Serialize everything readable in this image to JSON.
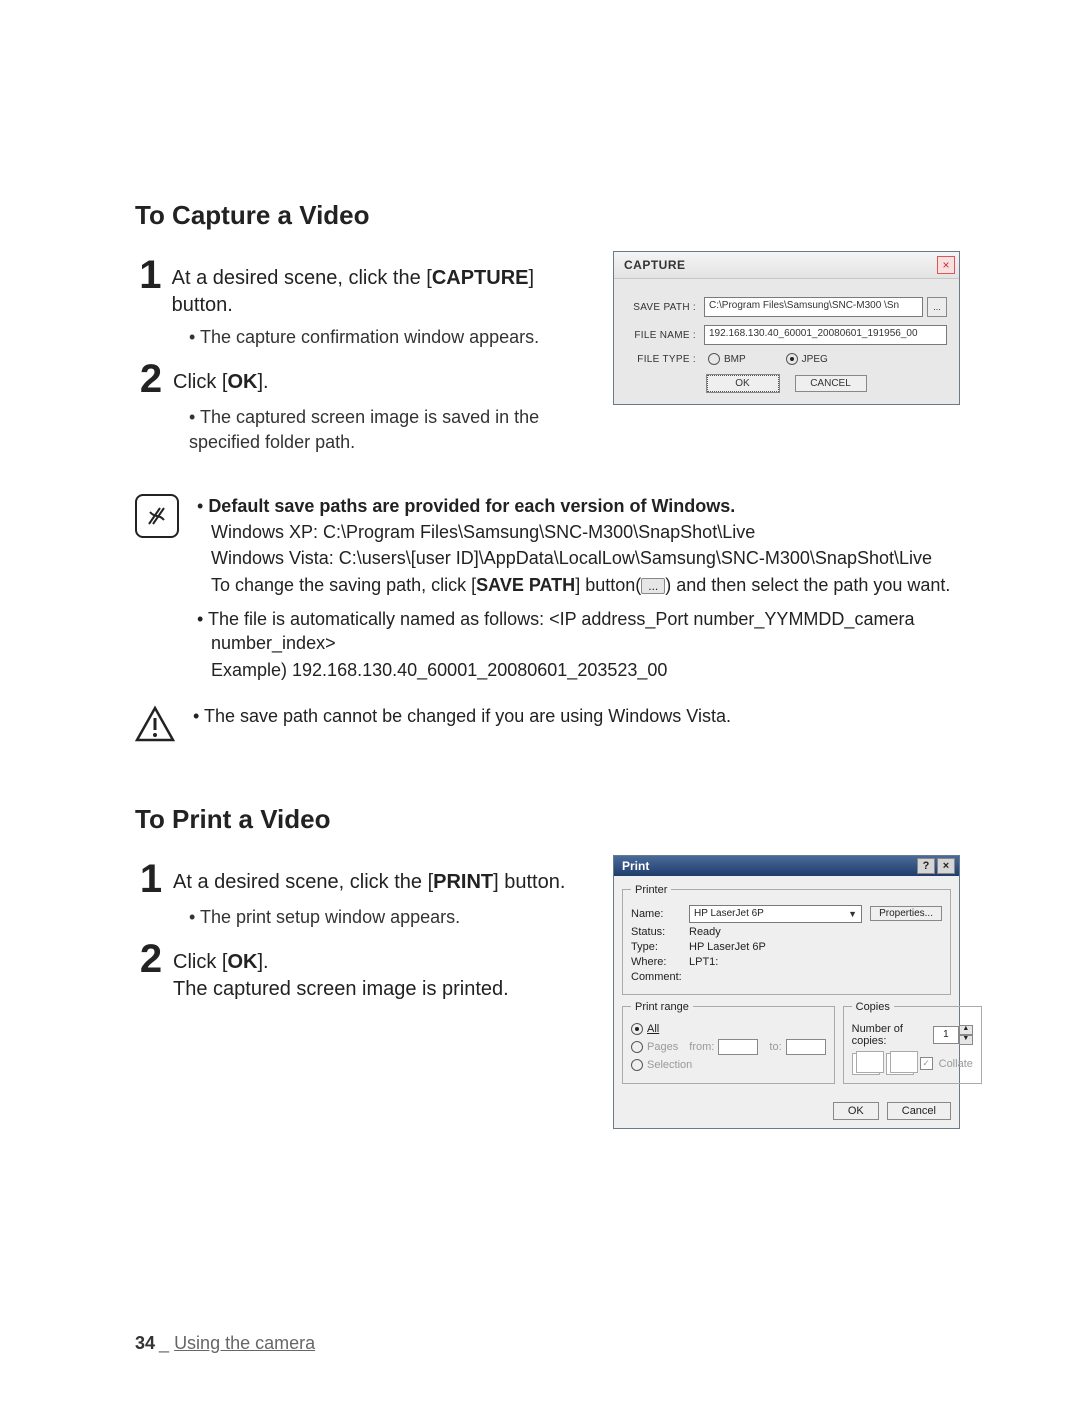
{
  "sections": {
    "capture": {
      "heading": "To Capture a Video",
      "step1_prefix": "At a desired scene, click the [",
      "step1_bold": "CAPTURE",
      "step1_suffix": "] button.",
      "step1_sub": "The capture confirmation window appears.",
      "step2_prefix": "Click [",
      "step2_bold": "OK",
      "step2_suffix": "].",
      "step2_sub": "The captured screen image is saved in the specified folder path."
    },
    "print": {
      "heading": "To Print a Video",
      "step1_prefix": "At a desired scene, click the [",
      "step1_bold": "PRINT",
      "step1_suffix": "] button.",
      "step1_sub": "The print setup window appears.",
      "step2_prefix": "Click [",
      "step2_bold": "OK",
      "step2_suffix": "].",
      "step2_body": "The captured screen image is printed."
    }
  },
  "numbers": {
    "one": "1",
    "two": "2"
  },
  "note": {
    "line1_bold": "Default save paths are provided for each version of Windows.",
    "line2": "Windows XP: C:\\Program Files\\Samsung\\SNC-M300\\SnapShot\\Live",
    "line3": "Windows Vista: C:\\users\\[user ID]\\AppData\\LocalLow\\Samsung\\SNC-M300\\SnapShot\\Live",
    "line4_a": "To change the saving path, click [",
    "line4_bold": "SAVE PATH",
    "line4_b": "] button(",
    "line4_btn": "...",
    "line4_c": ") and then select the path you want.",
    "line5": "The file is automatically named as follows: <IP address_Port number_YYMMDD_camera number_index>",
    "line6": "Example) 192.168.130.40_60001_20080601_203523_00"
  },
  "warn": {
    "line": "The save path cannot be changed if you are using Windows Vista."
  },
  "capture_dialog": {
    "title": "CAPTURE",
    "save_path_label": "SAVE PATH :",
    "save_path_value": "C:\\Program Files\\Samsung\\SNC-M300 \\Sn",
    "browse": "...",
    "file_name_label": "FILE NAME :",
    "file_name_value": "192.168.130.40_60001_20080601_191956_00",
    "file_type_label": "FILE TYPE :",
    "opt_bmp": "BMP",
    "opt_jpeg": "JPEG",
    "ok": "OK",
    "cancel": "CANCEL",
    "close": "×"
  },
  "print_dialog": {
    "title": "Print",
    "help": "?",
    "close": "×",
    "printer_group": "Printer",
    "name_label": "Name:",
    "name_value": "HP LaserJet 6P",
    "properties": "Properties...",
    "status_label": "Status:",
    "status_value": "Ready",
    "type_label": "Type:",
    "type_value": "HP LaserJet 6P",
    "where_label": "Where:",
    "where_value": "LPT1:",
    "comment_label": "Comment:",
    "range_group": "Print range",
    "range_all": "All",
    "range_pages": "Pages",
    "range_from": "from:",
    "range_to": "to:",
    "range_selection": "Selection",
    "copies_group": "Copies",
    "copies_label": "Number of copies:",
    "copies_value": "1",
    "collate": "Collate",
    "ok": "OK",
    "cancel": "Cancel"
  },
  "footer": {
    "page": "34",
    "sep": "_",
    "text": "Using the camera"
  }
}
